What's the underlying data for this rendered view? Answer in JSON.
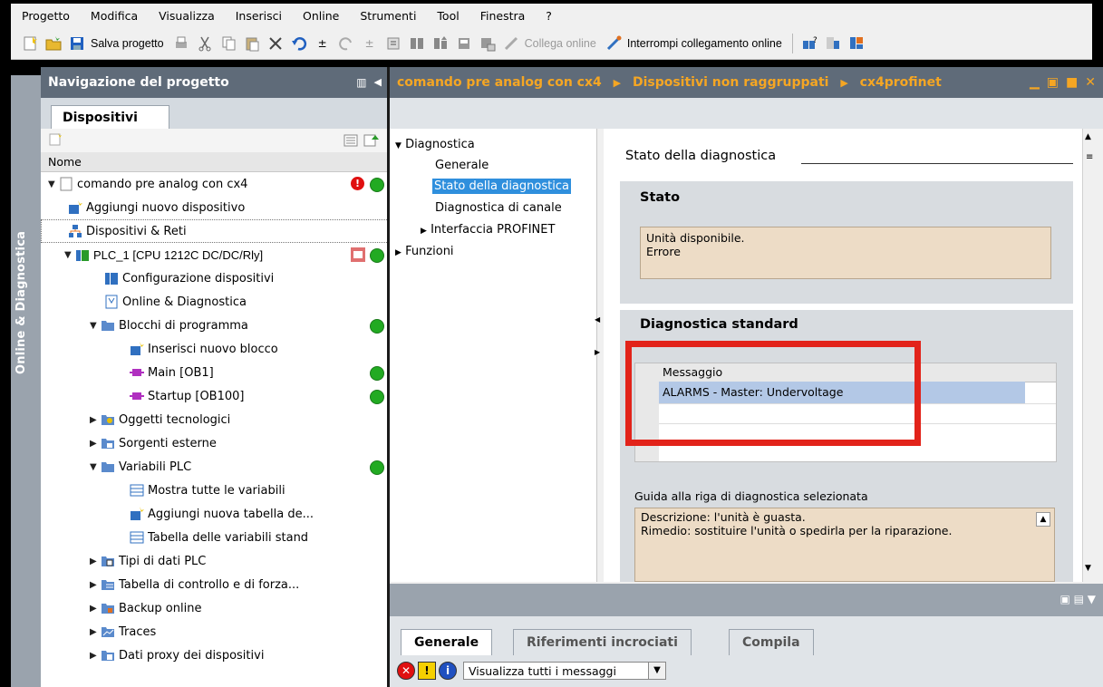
{
  "menu": [
    "Progetto",
    "Modifica",
    "Visualizza",
    "Inserisci",
    "Online",
    "Strumenti",
    "Tool",
    "Finestra",
    "?"
  ],
  "toolbar": {
    "save_label": "Salva progetto",
    "connect_label": "Collega online",
    "disconnect_label": "Interrompi collegamento online"
  },
  "vertical_tab": "Online & Diagnostica",
  "nav": {
    "title": "Navigazione del progetto",
    "tab": "Dispositivi",
    "column_header": "Nome",
    "tree": [
      {
        "label": "comando pre analog con cx4"
      },
      {
        "label": "Aggiungi nuovo dispositivo"
      },
      {
        "label": "Dispositivi & Reti"
      },
      {
        "label": "PLC_1 [CPU 1212C DC/DC/Rly]"
      },
      {
        "label": "Configurazione dispositivi"
      },
      {
        "label": "Online & Diagnostica"
      },
      {
        "label": "Blocchi di programma"
      },
      {
        "label": "Inserisci nuovo blocco"
      },
      {
        "label": "Main [OB1]"
      },
      {
        "label": "Startup [OB100]"
      },
      {
        "label": "Oggetti tecnologici"
      },
      {
        "label": "Sorgenti esterne"
      },
      {
        "label": "Variabili PLC"
      },
      {
        "label": "Mostra tutte le variabili"
      },
      {
        "label": "Aggiungi nuova tabella de..."
      },
      {
        "label": "Tabella delle variabili stand"
      },
      {
        "label": "Tipi di dati PLC"
      },
      {
        "label": "Tabella di controllo e di forza..."
      },
      {
        "label": "Backup online"
      },
      {
        "label": "Traces"
      },
      {
        "label": "Dati proxy dei dispositivi"
      }
    ]
  },
  "breadcrumb": {
    "project": "comando pre analog con cx4",
    "group": "Dispositivi non raggruppati",
    "device": "cx4profinet"
  },
  "diag_nav": {
    "diagnostica": "Diagnostica",
    "generale": "Generale",
    "stato": "Stato della diagnostica",
    "canale": "Diagnostica di canale",
    "profinet": "Interfaccia PROFINET",
    "funzioni": "Funzioni"
  },
  "content": {
    "page_title": "Stato della diagnostica",
    "stato_title": "Stato",
    "stato_line1": "Unità disponibile.",
    "stato_line2": "Errore",
    "std_title": "Diagnostica standard",
    "table_header": "Messaggio",
    "table_row": "ALARMS - Master: Undervoltage",
    "guide_label": "Guida alla riga di diagnostica selezionata",
    "desc": "Descrizione: l'unità è guasta.",
    "remedy": "Rimedio: sostituire l'unità o spedirla per la riparazione."
  },
  "inspector": {
    "tabs": [
      "Generale",
      "Riferimenti incrociati",
      "Compila"
    ],
    "filter": "Visualizza tutti i messaggi"
  },
  "colors": {
    "header_bg": "#5f6b79",
    "breadcrumb_text": "#f5a623",
    "selection": "#2f8fdd",
    "highlight_red": "#e2231a",
    "status_green": "#22aa22"
  }
}
